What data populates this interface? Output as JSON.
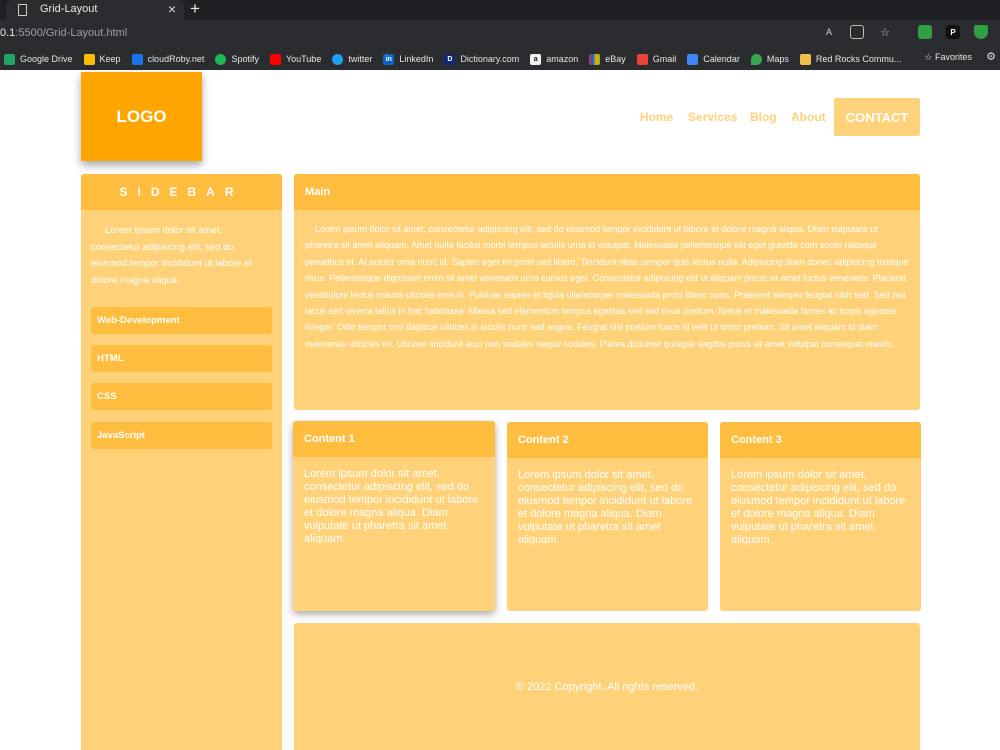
{
  "browser": {
    "tab_title": "Grid-Layout",
    "tab_close": "×",
    "new_tab": "+",
    "url_host": "0.1",
    "url_rest": ":5500/Grid-Layout.html",
    "bookmarks": [
      "Google Drive",
      "Keep",
      "cloudRoby.net",
      "Spotify",
      "YouTube",
      "twitter",
      "LinkedIn",
      "Dictionary.com",
      "amazon",
      "eBay",
      "Gmail",
      "Calendar",
      "Maps",
      "Red Rocks Commu..."
    ],
    "favorites": "Favorites"
  },
  "header": {
    "logo": "LOGO",
    "nav": [
      "Home",
      "Services",
      "Blog",
      "About"
    ],
    "contact": "CONTACT"
  },
  "sidebar": {
    "title": "SIDEBAR",
    "text": "Lorem ipsum dolor sit amet, consectetur adipiscing elit, sed do eiusmod tempor incididunt ut labore et dolore magna aliqua.",
    "items": [
      "Web-Development",
      "HTML",
      "CSS",
      "JavaScript"
    ]
  },
  "main": {
    "title": "Main",
    "text": "Lorem ipsum dolor sit amet, consectetur adipiscing elit, sed do eiusmod tempor incididunt ut labore et dolore magna aliqua. Diam vulputate ut pharetra sit amet aliquam. Amet nulla facilisi morbi tempus iaculis urna id volutpat. Malesuada pellentesque elit eget gravida cum sociis natoque penatibus et. At auctor urna nunc id. Sapien eget mi proin sed libero. Tincidunt vitae semper quis lectus nulla. Adipiscing diam donec adipiscing tristique risus. Pellentesque dignissim enim sit amet venenatis urna cursus eget. Consectetur adipiscing elit ut aliquam purus sit amet luctus venenatis. Placerat vestibulum lectus mauris ultrices eros in. Pulvinar sapien et ligula ullamcorper malesuada proin libero nunc. Praesent semper feugiat nibh sed. Sed nisi lacus sed viverra tellus in hac habitasse. Massa sed elementum tempus egestas sed sed risus pretium. Netus et malesuada fames ac turpis egestas integer. Odio tempor orci dapibus ultrices in iaculis nunc sed augue. Feugiat nisl pretium fusce id velit ut tortor pretium. Sit amet aliquam id diam maecenas ultricies mi. Ultrices tincidunt arcu non sodales neque sodales. Platea dictumst quisque sagittis purus sit amet volutpat consequat mauris."
  },
  "cards": [
    {
      "title": "Content 1",
      "text": "Lorem ipsum dolor sit amet, consectetur adipiscing elit, sed do eiusmod tempor incididunt ut labore et dolore magna aliqua. Diam vulputate ut pharetra sit amet aliquam."
    },
    {
      "title": "Content 2",
      "text": "Lorem ipsum dolor sit amet, consectetur adipiscing elit, sed do eiusmod tempor incididunt ut labore et dolore magna aliqua. Diam vulputate ut pharetra sit amet aliquam."
    },
    {
      "title": "Content 3",
      "text": "Lorem ipsum dolor sit amet, consectetur adipiscing elit, sed do eiusmod tempor incididunt ut labore et dolore magna aliqua. Diam vulputate ut pharetra sit amet aliquam."
    }
  ],
  "footer": {
    "text": "© 2022 Copyright. All rights reserved."
  },
  "colors": {
    "accent": "#ffa500",
    "header_bar": "#ffbd3f",
    "panel": "#ffd27a"
  }
}
